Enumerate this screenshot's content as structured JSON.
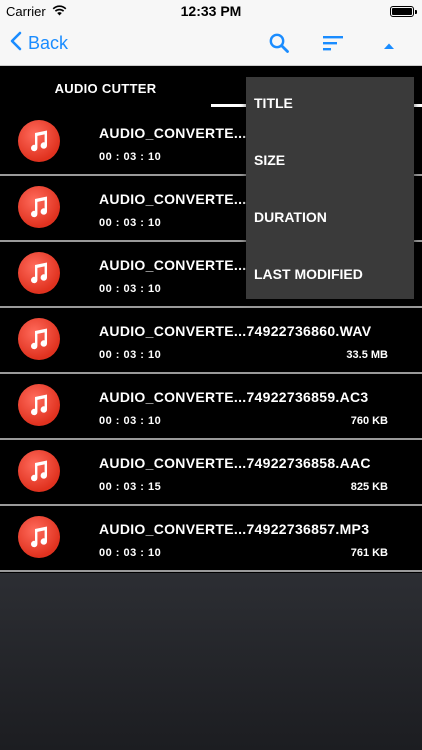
{
  "status_bar": {
    "carrier": "Carrier",
    "time": "12:33 PM"
  },
  "nav": {
    "back_label": "Back",
    "accent_color": "#1a8cff",
    "icons": [
      "search-icon",
      "sort-icon",
      "caret-up-icon"
    ]
  },
  "tab": {
    "label": "AUDIO CUTTER"
  },
  "files": [
    {
      "name": "AUDIO_CONVERTE...",
      "duration": "00 : 03 : 10",
      "size": ""
    },
    {
      "name": "AUDIO_CONVERTE...",
      "duration": "00 : 03 : 10",
      "size": ""
    },
    {
      "name": "AUDIO_CONVERTE...",
      "duration": "00 : 03 : 10",
      "size": ""
    },
    {
      "name": "AUDIO_CONVERTE...74922736860.WAV",
      "duration": "00 : 03 : 10",
      "size": "33.5 MB"
    },
    {
      "name": "AUDIO_CONVERTE...74922736859.AC3",
      "duration": "00 : 03 : 10",
      "size": "760 KB"
    },
    {
      "name": "AUDIO_CONVERTE...74922736858.AAC",
      "duration": "00 : 03 : 15",
      "size": "825 KB"
    },
    {
      "name": "AUDIO_CONVERTE...74922736857.MP3",
      "duration": "00 : 03 : 10",
      "size": "761 KB"
    }
  ],
  "sort_menu": {
    "items": [
      "TITLE",
      "SIZE",
      "DURATION",
      "LAST MODIFIED"
    ]
  }
}
